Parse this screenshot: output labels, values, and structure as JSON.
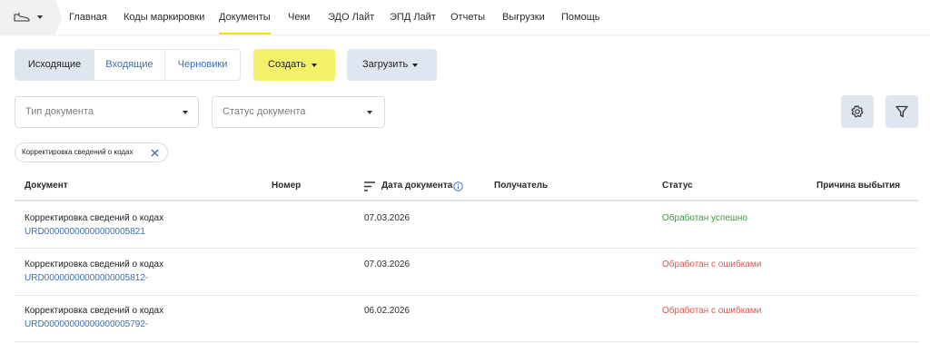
{
  "nav": {
    "items": [
      {
        "label": "Главная",
        "active": false
      },
      {
        "label": "Коды маркировки",
        "active": false
      },
      {
        "label": "Документы",
        "active": true
      },
      {
        "label": "Чеки",
        "active": false
      },
      {
        "label": "ЭДО Лайт",
        "active": false
      },
      {
        "label": "ЭПД Лайт",
        "active": false
      },
      {
        "label": "Отчеты",
        "active": false
      },
      {
        "label": "Выгрузки",
        "active": false
      },
      {
        "label": "Помощь",
        "active": false
      }
    ],
    "accent_color": "#f5e100"
  },
  "tabs": [
    {
      "label": "Исходящие",
      "selected": true
    },
    {
      "label": "Входящие",
      "selected": false
    },
    {
      "label": "Черновики",
      "selected": false
    }
  ],
  "actions": {
    "create_label": "Создать",
    "upload_label": "Загрузить",
    "create_color": "#f5f06a"
  },
  "filters": {
    "doc_type_placeholder": "Тип документа",
    "status_placeholder": "Статус документа",
    "chip_label": "Корректировка сведений о кодах"
  },
  "table": {
    "columns": [
      "Документ",
      "Номер",
      "Дата документа",
      "Получатель",
      "Статус",
      "Причина выбытия"
    ],
    "rows": [
      {
        "title": "Корректировка сведений о кодах",
        "id": "URD00000000000000005821",
        "number": "",
        "date": "07.03.2026",
        "recipient": "",
        "status": "Обработан успешно",
        "status_kind": "success",
        "reason": ""
      },
      {
        "title": "Корректировка сведений о кодах",
        "id": "URD00000000000000005812-",
        "number": "",
        "date": "07.03.2026",
        "recipient": "",
        "status": "Обработан с ошибками",
        "status_kind": "error",
        "reason": ""
      },
      {
        "title": "Корректировка сведений о кодах",
        "id": "URD00000000000000005792-",
        "number": "",
        "date": "06.02.2026",
        "recipient": "",
        "status": "Обработан с ошибками",
        "status_kind": "error",
        "reason": ""
      }
    ]
  }
}
